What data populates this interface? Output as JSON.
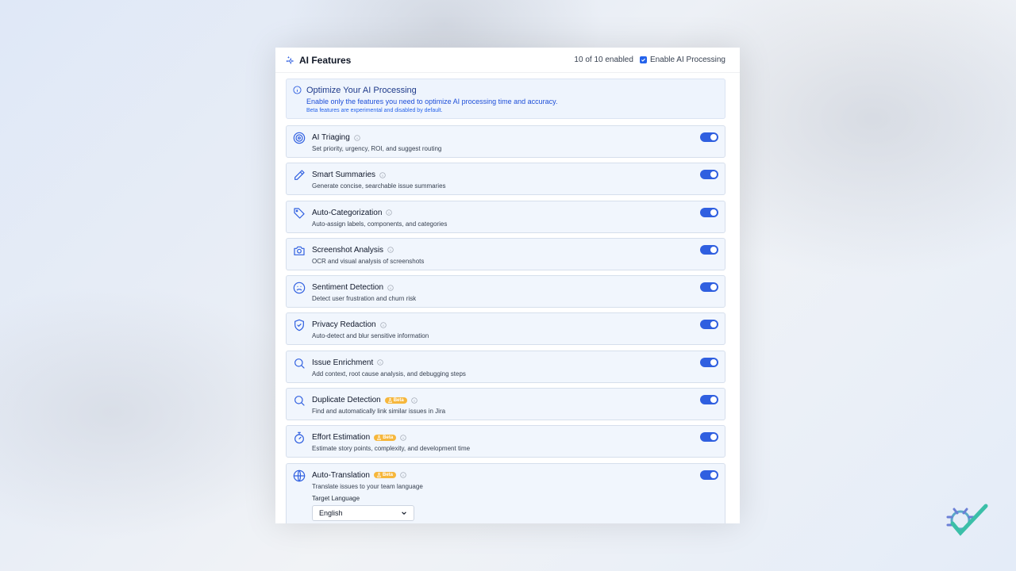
{
  "header": {
    "title": "AI Features",
    "count_text": "10 of 10 enabled",
    "enable_label": "Enable AI Processing",
    "enable_checked": true
  },
  "info": {
    "title": "Optimize Your AI Processing",
    "subtitle": "Enable only the features you need to optimize AI processing time and accuracy.",
    "note": "Beta features are experimental and disabled by default."
  },
  "beta_label": "Beta",
  "features": [
    {
      "name": "AI Triaging",
      "desc": "Set priority, urgency, ROI, and suggest routing",
      "icon": "target-icon",
      "beta": false,
      "enabled": true
    },
    {
      "name": "Smart Summaries",
      "desc": "Generate concise, searchable issue summaries",
      "icon": "pencil-icon",
      "beta": false,
      "enabled": true
    },
    {
      "name": "Auto-Categorization",
      "desc": "Auto-assign labels, components, and categories",
      "icon": "tag-icon",
      "beta": false,
      "enabled": true
    },
    {
      "name": "Screenshot Analysis",
      "desc": "OCR and visual analysis of screenshots",
      "icon": "camera-icon",
      "beta": false,
      "enabled": true
    },
    {
      "name": "Sentiment Detection",
      "desc": "Detect user frustration and churn risk",
      "icon": "frown-icon",
      "beta": false,
      "enabled": true
    },
    {
      "name": "Privacy Redaction",
      "desc": "Auto-detect and blur sensitive information",
      "icon": "shield-check-icon",
      "beta": false,
      "enabled": true
    },
    {
      "name": "Issue Enrichment",
      "desc": "Add context, root cause analysis, and debugging steps",
      "icon": "search-icon",
      "beta": false,
      "enabled": true
    },
    {
      "name": "Duplicate Detection",
      "desc": "Find and automatically link similar issues in Jira",
      "icon": "search-icon",
      "beta": true,
      "enabled": true
    },
    {
      "name": "Effort Estimation",
      "desc": "Estimate story points, complexity, and development time",
      "icon": "stopwatch-icon",
      "beta": true,
      "enabled": true
    },
    {
      "name": "Auto-Translation",
      "desc": "Translate issues to your team language",
      "icon": "globe-icon",
      "beta": true,
      "enabled": true
    }
  ],
  "translation": {
    "target_label": "Target Language",
    "selected": "English"
  },
  "colors": {
    "accent": "#2f5fe0",
    "beta": "#f6b73c",
    "card_bg": "#f1f6fd"
  }
}
